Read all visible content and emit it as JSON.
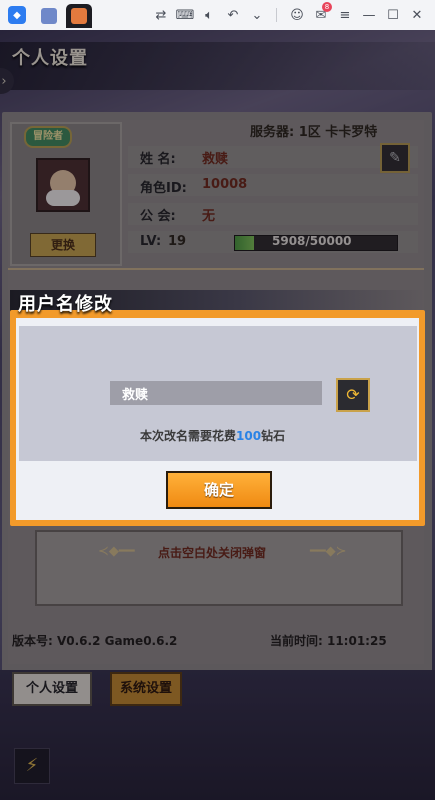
{
  "emulator": {
    "badge_count": "8",
    "icons": [
      "app-logo-icon",
      "game-tab-icon",
      "active-tab-icon",
      "cast-icon",
      "keyboard-icon",
      "volume-icon",
      "undo-icon",
      "chevron-down-icon",
      "user-icon",
      "mail-icon",
      "menu-icon",
      "minimize-icon",
      "maximize-icon",
      "close-icon"
    ]
  },
  "page": {
    "title": "个人设置"
  },
  "profile": {
    "avatar_tag": "冒险者",
    "change_button": "更换",
    "server": "服务器: 1区 卡卡罗特",
    "name_label": "姓  名:",
    "name_value": "救赎",
    "role_id_label": "角色ID:",
    "role_id_value": "10008",
    "guild_label": "公  会:",
    "guild_value": "无",
    "level_label": "LV:",
    "level_value": "19",
    "exp_text": "5908/50000",
    "exp_progress": 0.118
  },
  "modal": {
    "title": "用户名修改",
    "name_input_value": "救赎",
    "cost_prefix": "本次改名需要花费",
    "cost_amount": "100",
    "cost_suffix": "钻石",
    "confirm_button": "确定"
  },
  "notice": {
    "close_hint": "点击空白处关闭弹窗"
  },
  "footer": {
    "version": "版本号: V0.6.2 Game0.6.2",
    "time": "当前时间: 11:01:25"
  },
  "tabs": {
    "personal": "个人设置",
    "system": "系统设置"
  },
  "colors": {
    "accent_orange": "#f29a2a",
    "cost_blue": "#2a83e6",
    "name_red": "#6e2716"
  }
}
